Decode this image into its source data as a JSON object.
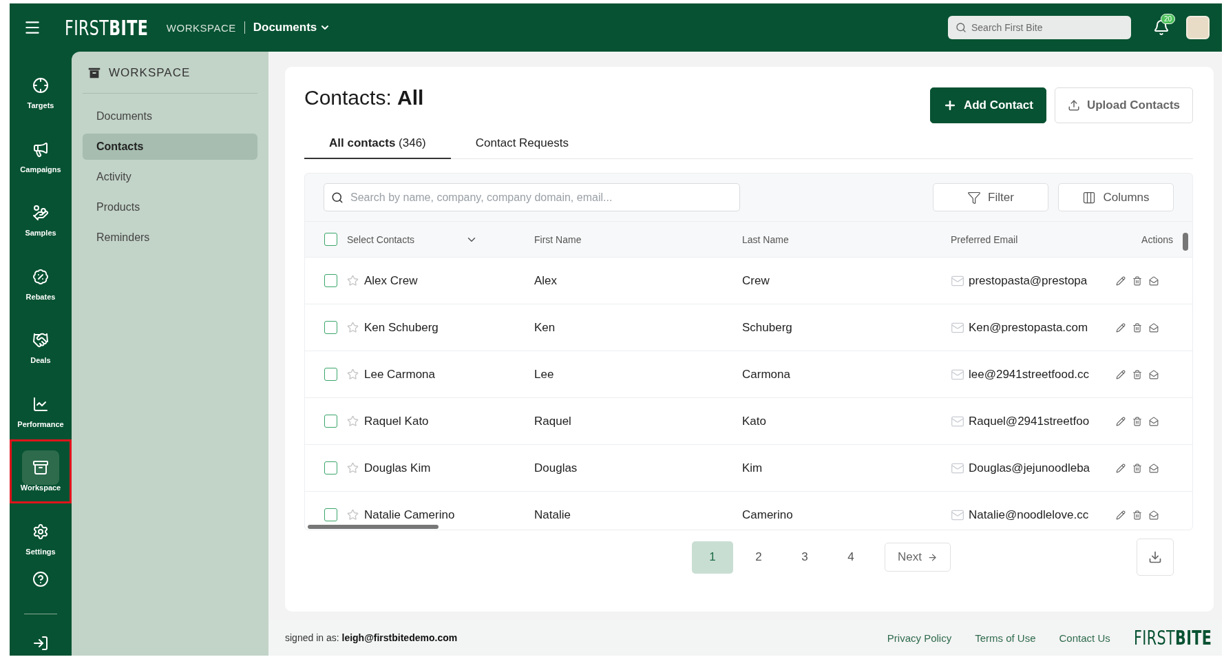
{
  "topbar": {
    "logo": "FIRST**BITE**",
    "section": "WORKSPACE",
    "page": "Documents",
    "search": {
      "placeholder": "Search First Bite"
    },
    "notifications": "20"
  },
  "nav": [
    {
      "label": "Targets",
      "selected": false,
      "highlighted": false
    },
    {
      "label": "Campaigns",
      "selected": false,
      "highlighted": false
    },
    {
      "label": "Samples",
      "selected": false,
      "highlighted": false
    },
    {
      "label": "Rebates",
      "selected": false,
      "highlighted": false
    },
    {
      "label": "Deals",
      "selected": false,
      "highlighted": false
    },
    {
      "label": "Performance",
      "selected": false,
      "highlighted": false
    },
    {
      "label": "Workspace",
      "selected": true,
      "highlighted": true
    },
    {
      "label": "Settings",
      "selected": false,
      "highlighted": false
    }
  ],
  "sidebar": {
    "title": "WORKSPACE",
    "items": [
      {
        "label": "Documents",
        "selected": false
      },
      {
        "label": "Contacts",
        "selected": true
      },
      {
        "label": "Activity",
        "selected": false
      },
      {
        "label": "Products",
        "selected": false
      },
      {
        "label": "Reminders",
        "selected": false
      }
    ]
  },
  "page": {
    "title": "Contacts: **All**",
    "buttons": [
      {
        "label": "Add Contact",
        "kind": "primary"
      },
      {
        "label": "Upload Contacts",
        "kind": "secondary"
      }
    ]
  },
  "tabs": [
    {
      "label": "All contacts",
      "count": "(346)",
      "selected": true
    },
    {
      "label": "Contact Requests",
      "selected": false
    }
  ],
  "search": {
    "placeholder": "Search by name, company, company domain, email..."
  },
  "tools": [
    {
      "label": "Filter",
      "kind": "filter"
    },
    {
      "label": "Columns",
      "kind": "columns"
    }
  ],
  "table": {
    "select_all": {
      "label": "Select Contacts",
      "checked": false
    },
    "columns": [
      "First Name",
      "Last Name",
      "Preferred Email",
      "Actions"
    ],
    "rows": [
      {
        "name": "Alex Crew",
        "first": "Alex",
        "last": "Crew",
        "email": "prestopasta@prestopa",
        "checked": false,
        "starred": false
      },
      {
        "name": "Ken Schuberg",
        "first": "Ken",
        "last": "Schuberg",
        "email": "Ken@prestopasta.com",
        "checked": false,
        "starred": false
      },
      {
        "name": "Lee Carmona",
        "first": "Lee",
        "last": "Carmona",
        "email": "lee@2941streetfood.cc",
        "checked": false,
        "starred": false
      },
      {
        "name": "Raquel Kato",
        "first": "Raquel",
        "last": "Kato",
        "email": "Raquel@2941streetfoo",
        "checked": false,
        "starred": false
      },
      {
        "name": "Douglas Kim",
        "first": "Douglas",
        "last": "Kim",
        "email": "Douglas@jejunoodleba",
        "checked": false,
        "starred": false
      },
      {
        "name": "Natalie Camerino",
        "first": "Natalie",
        "last": "Camerino",
        "email": "Natalie@noodlelove.cc",
        "checked": false,
        "starred": false
      }
    ]
  },
  "pagination": {
    "pages": [
      {
        "label": "1",
        "selected": true
      },
      {
        "label": "2",
        "selected": false
      },
      {
        "label": "3",
        "selected": false
      },
      {
        "label": "4",
        "selected": false
      }
    ],
    "next": "Next"
  },
  "footer": {
    "signed_in": "signed in as: **leigh@firstbitedemo.com**",
    "links": [
      "Privacy Policy",
      "Terms of Use",
      "Contact Us"
    ],
    "logo": "FIRST**BITE**"
  }
}
